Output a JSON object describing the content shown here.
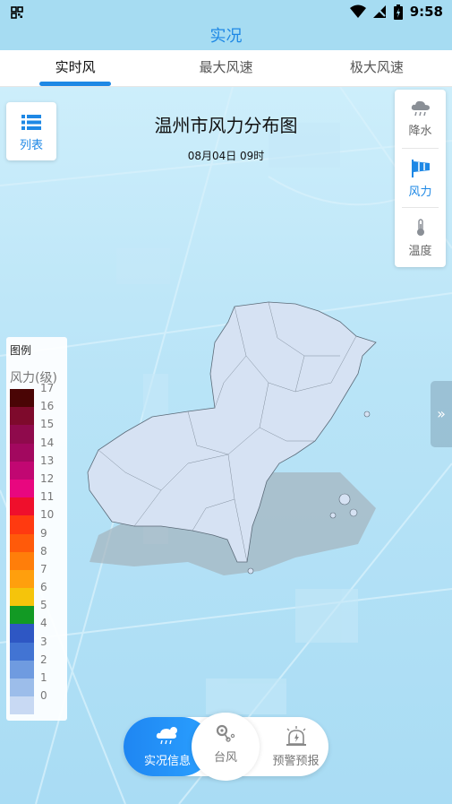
{
  "status_bar": {
    "time": "9:58"
  },
  "header": {
    "title": "实况"
  },
  "tabs": [
    {
      "label": "实时风",
      "active": true
    },
    {
      "label": "最大风速",
      "active": false
    },
    {
      "label": "极大风速",
      "active": false
    }
  ],
  "list_button": {
    "label": "列表",
    "icon": "list-icon"
  },
  "map": {
    "title": "温州市风力分布图",
    "time": "08月04日 09时"
  },
  "layers": [
    {
      "label": "降水",
      "icon": "rain-cloud-icon",
      "active": false
    },
    {
      "label": "风力",
      "icon": "wind-flag-icon",
      "active": true
    },
    {
      "label": "温度",
      "icon": "thermometer-icon",
      "active": false
    }
  ],
  "legend": {
    "title": "图例",
    "unit": "风力(级)",
    "levels": [
      {
        "level": "17",
        "color": "#4a0505"
      },
      {
        "level": "16",
        "color": "#7e0a2c"
      },
      {
        "level": "15",
        "color": "#8f0a4c"
      },
      {
        "level": "14",
        "color": "#a2085f"
      },
      {
        "level": "13",
        "color": "#c10772"
      },
      {
        "level": "12",
        "color": "#e8077f"
      },
      {
        "level": "11",
        "color": "#ef0f2c"
      },
      {
        "level": "10",
        "color": "#ff3a10"
      },
      {
        "level": "9",
        "color": "#ff5a0a"
      },
      {
        "level": "8",
        "color": "#ff7e0a"
      },
      {
        "level": "7",
        "color": "#ff9f0d"
      },
      {
        "level": "6",
        "color": "#f5c40b"
      },
      {
        "level": "5",
        "color": "#129a24"
      },
      {
        "level": "4",
        "color": "#2e57c4"
      },
      {
        "level": "3",
        "color": "#4274d3"
      },
      {
        "level": "2",
        "color": "#6f9be0"
      },
      {
        "level": "1",
        "color": "#9cbdea"
      },
      {
        "level": "0",
        "color": "#c8d9f3"
      }
    ]
  },
  "bottom_nav": [
    {
      "label": "实况信息",
      "icon": "weather-live-icon",
      "active": true
    },
    {
      "label": "台风",
      "icon": "typhoon-icon",
      "active": false
    },
    {
      "label": "预警预报",
      "icon": "alert-siren-icon",
      "active": false
    }
  ]
}
